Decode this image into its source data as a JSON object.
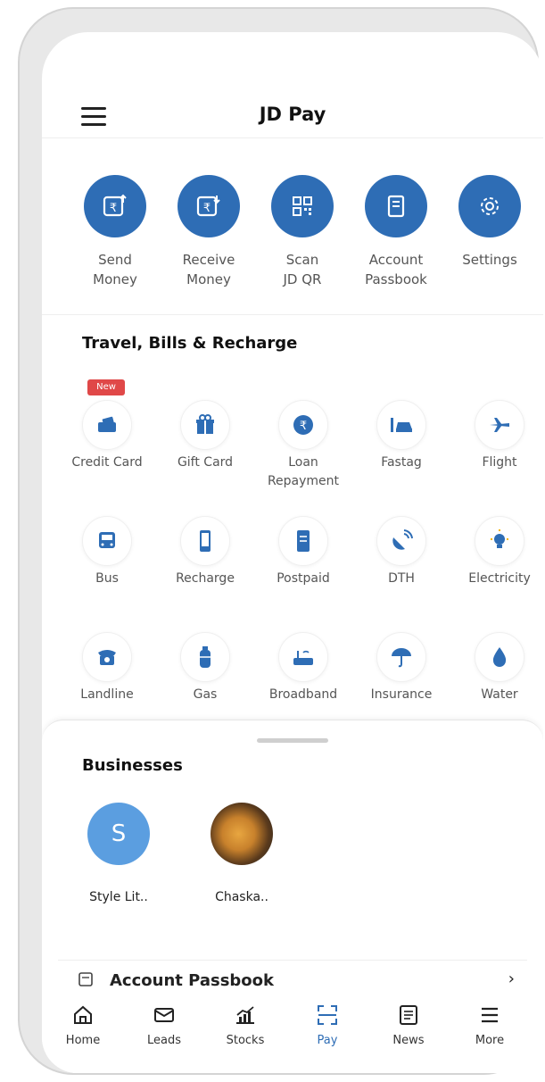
{
  "header": {
    "title": "JD Pay",
    "menu_icon": "hamburger-menu-icon"
  },
  "quick_actions": [
    {
      "label": "Send\nMoney",
      "icon": "send-money-icon"
    },
    {
      "label": "Receive\nMoney",
      "icon": "receive-money-icon"
    },
    {
      "label": "Scan\nJD QR",
      "icon": "qr-scan-icon"
    },
    {
      "label": "Account\nPassbook",
      "icon": "passbook-icon"
    },
    {
      "label": "Settings",
      "icon": "gear-icon"
    }
  ],
  "travel": {
    "title": "Travel, Bills & Recharge",
    "new_badge": "New",
    "items": [
      {
        "label": "Credit Card",
        "icon": "credit-card-icon"
      },
      {
        "label": "Gift Card",
        "icon": "gift-icon"
      },
      {
        "label": "Loan\nRepayment",
        "icon": "rupee-coin-icon"
      },
      {
        "label": "Fastag",
        "icon": "car-tag-icon"
      },
      {
        "label": "Flight",
        "icon": "airplane-icon"
      },
      {
        "label": "Bus",
        "icon": "bus-icon"
      },
      {
        "label": "Recharge",
        "icon": "mobile-icon"
      },
      {
        "label": "Postpaid",
        "icon": "bill-icon"
      },
      {
        "label": "DTH",
        "icon": "satellite-dish-icon"
      },
      {
        "label": "Electricity",
        "icon": "bulb-icon"
      },
      {
        "label": "Landline",
        "icon": "telephone-icon"
      },
      {
        "label": "Gas",
        "icon": "gas-cylinder-icon"
      },
      {
        "label": "Broadband",
        "icon": "router-icon"
      },
      {
        "label": "Insurance",
        "icon": "umbrella-icon"
      },
      {
        "label": "Water",
        "icon": "water-drop-icon"
      }
    ]
  },
  "businesses": {
    "title": "Businesses",
    "items": [
      {
        "label": "Style Lit..",
        "initial": "S"
      },
      {
        "label": "Chaska.."
      }
    ]
  },
  "passbook_row": {
    "label": "Account Passbook",
    "icon": "passbook-icon",
    "arrow": "›"
  },
  "tabs": [
    {
      "label": "Home",
      "icon": "home-icon"
    },
    {
      "label": "Leads",
      "icon": "mail-icon"
    },
    {
      "label": "Stocks",
      "icon": "stocks-chart-icon"
    },
    {
      "label": "Pay",
      "icon": "scan-icon",
      "active": true
    },
    {
      "label": "News",
      "icon": "news-icon"
    },
    {
      "label": "More",
      "icon": "more-menu-icon"
    }
  ],
  "colors": {
    "primary": "#2e6db5",
    "new_badge": "#e04848",
    "avatar_s": "#5b9ee0"
  }
}
